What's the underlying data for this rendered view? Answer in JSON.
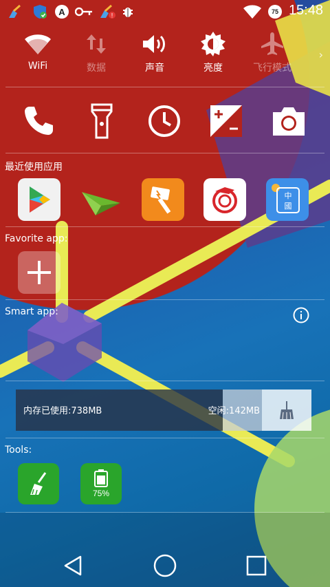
{
  "status_bar": {
    "time": "15:48",
    "signal_badge": "75",
    "icons": [
      "broom-icon",
      "shield-check-icon",
      "a-badge-icon",
      "key-icon",
      "broom-alert-icon",
      "bug-icon"
    ]
  },
  "quick_settings": [
    {
      "label": "WiFi",
      "icon": "wifi-icon",
      "active": true
    },
    {
      "label": "数据",
      "icon": "data-arrows-icon",
      "active": false
    },
    {
      "label": "声音",
      "icon": "volume-icon",
      "active": true
    },
    {
      "label": "亮度",
      "icon": "brightness-icon",
      "active": true
    },
    {
      "label": "飞行模式",
      "icon": "airplane-icon",
      "active": false
    }
  ],
  "tools_row": [
    "phone-icon",
    "flashlight-icon",
    "clock-icon",
    "calculator-icon",
    "camera-icon"
  ],
  "sections": {
    "recent_apps": "最近使用应用",
    "favorite_apps": "Favorite app:",
    "smart_apps": "Smart app:",
    "tools": "Tools:"
  },
  "recent_apps": [
    {
      "name": "play-store-app",
      "bg": "#f1f1f1"
    },
    {
      "name": "paper-plane-app",
      "bg": "transparent"
    },
    {
      "name": "hammer-app",
      "bg": "#f28a1c"
    },
    {
      "name": "dragon-app",
      "bg": "#ffffff"
    },
    {
      "name": "chinese-seal-app",
      "bg": "#3d8fe8"
    }
  ],
  "memory": {
    "used_label": "内存已使用:738MB",
    "free_label": "空闲:142MB",
    "used_fraction": 0.84
  },
  "tools": {
    "battery_percent": "75%"
  },
  "colors": {
    "accent_red": "#b3231c",
    "tool_green": "#2aa52b",
    "bg_blue": "#1872b8"
  }
}
